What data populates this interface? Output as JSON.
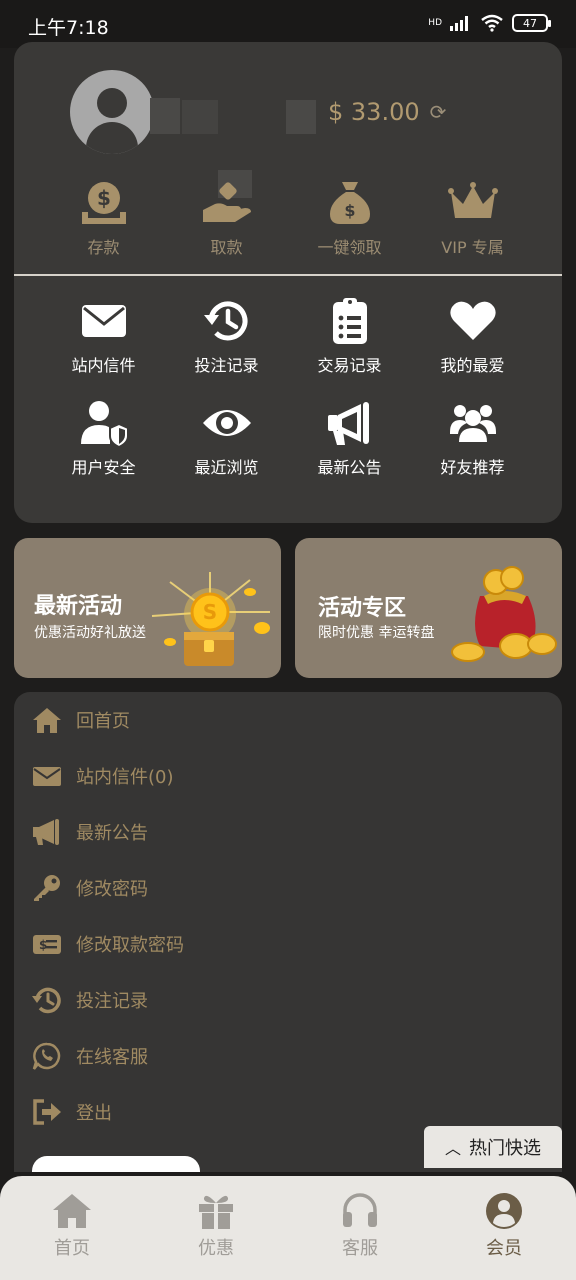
{
  "status_bar": {
    "time": "上午7:18",
    "network": "HD",
    "battery": "47"
  },
  "profile": {
    "balance": "$ 33.00"
  },
  "wallet_actions": [
    {
      "label": "存款",
      "icon": "deposit-money-icon"
    },
    {
      "label": "取款",
      "icon": "withdraw-hand-icon"
    },
    {
      "label": "一键领取",
      "icon": "money-bag-icon"
    },
    {
      "label": "VIP 专属",
      "icon": "crown-icon"
    }
  ],
  "functions": [
    {
      "label": "站内信件",
      "icon": "envelope-icon"
    },
    {
      "label": "投注记录",
      "icon": "history-icon"
    },
    {
      "label": "交易记录",
      "icon": "clipboard-list-icon"
    },
    {
      "label": "我的最爱",
      "icon": "heart-icon"
    },
    {
      "label": "用户安全",
      "icon": "user-shield-icon"
    },
    {
      "label": "最近浏览",
      "icon": "eye-icon"
    },
    {
      "label": "最新公告",
      "icon": "megaphone-icon"
    },
    {
      "label": "好友推荐",
      "icon": "users-icon"
    }
  ],
  "promos": [
    {
      "title": "最新活动",
      "subtitle": "优惠活动好礼放送"
    },
    {
      "title": "活动专区",
      "subtitle": "限时优惠 幸运转盘"
    }
  ],
  "menu": [
    {
      "label": "回首页",
      "icon": "home-icon"
    },
    {
      "label": "站内信件(0)",
      "icon": "envelope-icon"
    },
    {
      "label": "最新公告",
      "icon": "megaphone-icon"
    },
    {
      "label": "修改密码",
      "icon": "key-icon"
    },
    {
      "label": "修改取款密码",
      "icon": "card-icon"
    },
    {
      "label": "投注记录",
      "icon": "history-icon"
    },
    {
      "label": "在线客服",
      "icon": "whatsapp-icon"
    },
    {
      "label": "登出",
      "icon": "logout-icon"
    }
  ],
  "hot_button": {
    "label": "热门快选"
  },
  "bottom_nav": [
    {
      "label": "首页",
      "icon": "home-icon"
    },
    {
      "label": "优惠",
      "icon": "gift-icon"
    },
    {
      "label": "客服",
      "icon": "headset-icon"
    },
    {
      "label": "会员",
      "icon": "member-icon",
      "active": true
    }
  ],
  "colors": {
    "accent_gold": "#a08a62",
    "card_bg": "#3a3937",
    "promo_bg": "#8a7e6e"
  }
}
